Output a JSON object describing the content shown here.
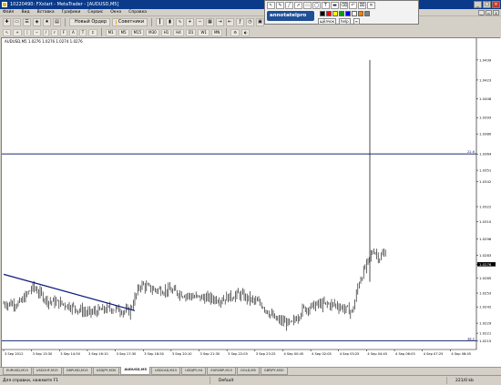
{
  "window": {
    "title": "10220490: FXstart - MetaTrader - [AUDUSD,M5]",
    "buttons": [
      "_",
      "□",
      "×"
    ]
  },
  "menu": {
    "items": [
      "Файл",
      "Вид",
      "Вставка",
      "Графики",
      "Сервис",
      "Окно",
      "Справка"
    ]
  },
  "toolbar": {
    "new_order_label": "Новый Ордер",
    "advisors_label": "Советники",
    "timeframes": [
      "M1",
      "M5",
      "M15",
      "M30",
      "H1",
      "H4",
      "D1",
      "W1",
      "MN"
    ]
  },
  "annotate": {
    "logo_text": "annotatelpro",
    "tool_icons": [
      "cursor-icon",
      "pen-icon",
      "line-icon",
      "arrow-icon",
      "rectangle-icon",
      "ellipse-icon",
      "text-icon",
      "highlight-icon",
      "eraser-icon",
      "undo-icon",
      "clear-icon",
      "close-icon"
    ],
    "options": [
      "щёлчок",
      "help",
      "≡"
    ],
    "colors": [
      "#000000",
      "#ff0000",
      "#ffff00",
      "#00a000",
      "#0000ff",
      "#ffffff",
      "#ff8000",
      "#808080"
    ]
  },
  "chart": {
    "header": "AUDUSD,M5  1.0276 1.0276 1.0274 1.0276",
    "hline_labels": [
      "22.6",
      "38.2"
    ],
    "colors": {
      "hline": "#1c2a6e",
      "trend": "#0d1b7a",
      "candle": "#000000",
      "current_price_bg": "#000000"
    }
  },
  "chart_data": {
    "type": "candlestick",
    "y_ticks": [
      "1.0439",
      "1.0423",
      "1.0408",
      "1.0393",
      "1.0380",
      "1.0364",
      "1.0351",
      "1.0342",
      "1.0322",
      "1.0310",
      "1.0296",
      "1.0283",
      "1.0276",
      "1.0265",
      "1.0253",
      "1.0242",
      "1.0229",
      "1.0221",
      "1.0215"
    ],
    "current_price": "1.0276",
    "x_ticks": [
      "3 Sep 2012",
      "3 Sep 13:30",
      "3 Sep 14:50",
      "3 Sep 16:10",
      "3 Sep 17:30",
      "3 Sep 18:50",
      "3 Sep 20:10",
      "3 Sep 21:30",
      "3 Sep 22:05",
      "3 Sep 23:25",
      "4 Sep 00:45",
      "4 Sep 02:05",
      "4 Sep 03:25",
      "4 Sep 04:45",
      "4 Sep 06:05",
      "4 Sep 07:25",
      "4 Sep 08:45"
    ],
    "horizontal_lines": [
      {
        "label": "22.6",
        "price": 1.0364
      },
      {
        "label": "38.2",
        "price": 1.0215
      }
    ],
    "spike": {
      "time": "4 Sep 06:50",
      "high": 1.0439
    }
  },
  "tabs": [
    "EURUSD,M15",
    "USDCHF,M15",
    "GBPUSD,M15",
    "USDJPY,M30",
    "AUDUSD,M5",
    "USDCAD,M15",
    "USDJPY,H4",
    "EURGBP,M15",
    "GOLD,M5",
    "GBPJPY,M30"
  ],
  "active_tab": "AUDUSD,M5",
  "status": {
    "help": "Для справки, нажмите F1",
    "profile": "Default",
    "traffic": "221/0 kb"
  }
}
